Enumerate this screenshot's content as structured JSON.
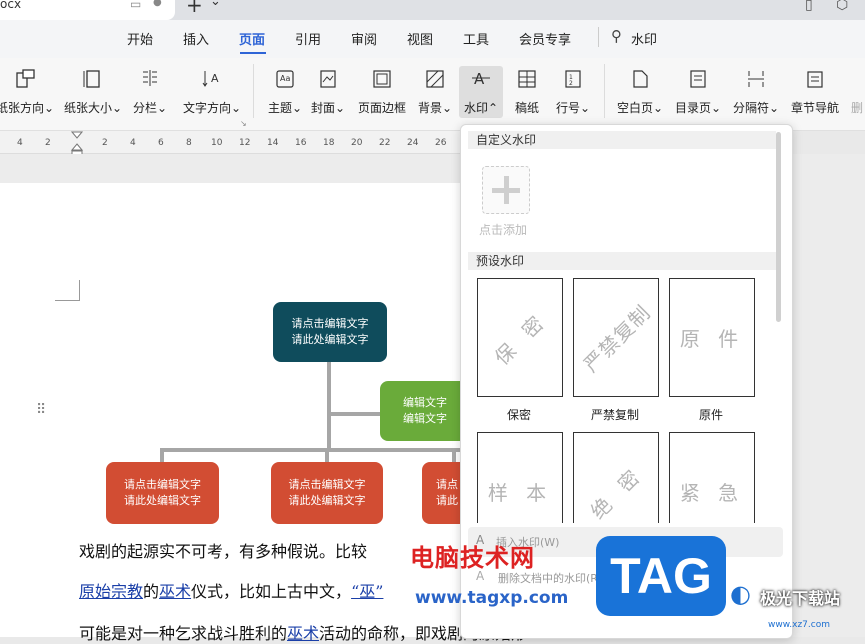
{
  "window": {
    "doc_tab_label": "ocx",
    "add_tab": "+",
    "tab_dropdown": "⌄"
  },
  "menu": {
    "items": [
      "开始",
      "插入",
      "页面",
      "引用",
      "审阅",
      "视图",
      "工具",
      "会员专享"
    ],
    "active": "页面",
    "search_text": "水印",
    "accent_color": "#2e64d6"
  },
  "ribbon": {
    "buttons": [
      "纸张方向",
      "纸张大小",
      "分栏",
      "文字方向",
      "主题",
      "封面",
      "页面边框",
      "背景",
      "水印",
      "稿纸",
      "行号",
      "空白页",
      "目录页",
      "分隔符",
      "章节导航",
      "删"
    ],
    "dropdown_suffix": "⌄"
  },
  "ruler": {
    "numbers": [
      "4",
      "2",
      "2",
      "4",
      "6",
      "8",
      "10",
      "12",
      "14",
      "16",
      "18",
      "20",
      "22",
      "24",
      "26"
    ]
  },
  "diagram": {
    "root": [
      "请点击编辑文字",
      "请此处编辑文字"
    ],
    "side": [
      "编辑文字",
      "编辑文字"
    ],
    "child1": [
      "请点击编辑文字",
      "请此处编辑文字"
    ],
    "child2": [
      "请点击编辑文字",
      "请此处编辑文字"
    ],
    "child3": [
      "请点",
      "请此"
    ],
    "colors": {
      "root": "#0f4c5c",
      "side": "#6aab3a",
      "child": "#d24d33"
    }
  },
  "body_text": {
    "line1": "戏剧的起源实不可考，有多种假说。比较",
    "line2_a": "原始宗教",
    "line2_b": "的",
    "line2_c": "巫术",
    "line2_d": "仪式，比如上古中文，",
    "line2_e": "“巫”",
    "line3_a": "可能是对一种乞求战斗胜利的",
    "line3_b": "巫术",
    "line3_c": "活动的命称，即戏剧的原始形"
  },
  "watermark_panel": {
    "custom_section": "自定义水印",
    "add_label": "点击添加",
    "preset_section": "预设水印",
    "presets": [
      {
        "text": "保 密",
        "caption": "保密"
      },
      {
        "text": "严禁复制",
        "caption": "严禁复制"
      },
      {
        "text": "原 件",
        "caption": "原件"
      },
      {
        "text": "样 本",
        "caption": ""
      },
      {
        "text": "绝 密",
        "caption": ""
      },
      {
        "text": "紧 急",
        "caption": ""
      }
    ],
    "insert_label": "插入水印(W)",
    "delete_label": "删除文档中的水印(R)"
  },
  "overlay": {
    "brand_cn": "电脑技术网",
    "brand_url": "www.tagxp.com",
    "tag": "TAG",
    "xz7": "极光下载站",
    "xz7_url": "www.xz7.com"
  }
}
